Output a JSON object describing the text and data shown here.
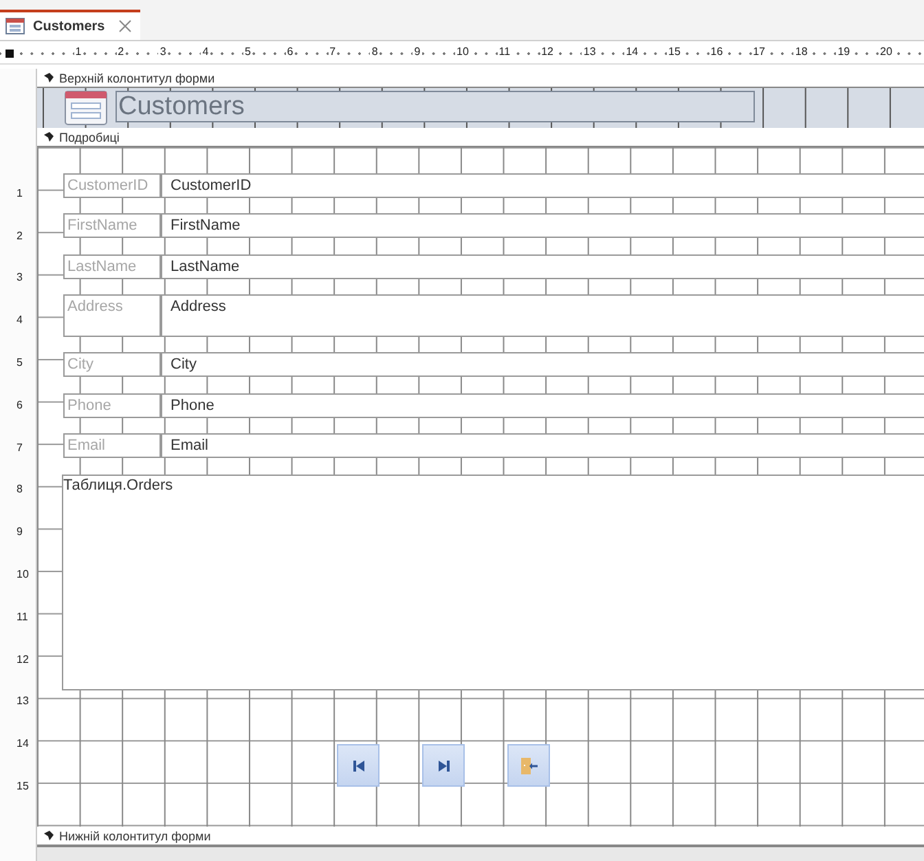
{
  "tab": {
    "title": "Customers"
  },
  "ruler": {
    "columns": [
      "1",
      "2",
      "3",
      "4",
      "5",
      "6",
      "7",
      "8",
      "9",
      "10",
      "11",
      "12",
      "13",
      "14",
      "15",
      "16",
      "17",
      "18",
      "19",
      "20"
    ],
    "rows": [
      "1",
      "2",
      "3",
      "4",
      "5",
      "6",
      "7",
      "8",
      "9",
      "10",
      "11",
      "12",
      "13",
      "14",
      "15"
    ]
  },
  "sections": {
    "header": "Верхній колонтитул форми",
    "detail": "Подробиці",
    "footer": "Нижній колонтитул форми"
  },
  "form_title": "Customers",
  "fields": [
    {
      "label": "CustomerID",
      "value": "CustomerID",
      "kind": "single"
    },
    {
      "label": "FirstName",
      "value": "FirstName",
      "kind": "single"
    },
    {
      "label": "LastName",
      "value": "LastName",
      "kind": "single"
    },
    {
      "label": "Address",
      "value": "Address",
      "kind": "multiline"
    },
    {
      "label": "City",
      "value": "City",
      "kind": "single"
    },
    {
      "label": "Phone",
      "value": "Phone",
      "kind": "single"
    },
    {
      "label": "Email",
      "value": "Email",
      "kind": "single"
    }
  ],
  "subform": {
    "label": "Таблиця.Orders"
  },
  "buttons": [
    {
      "kind": "first"
    },
    {
      "kind": "last"
    },
    {
      "kind": "exit"
    }
  ]
}
